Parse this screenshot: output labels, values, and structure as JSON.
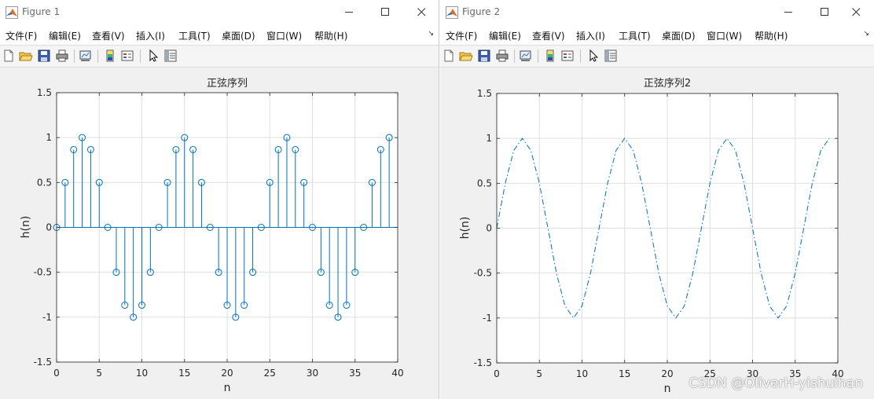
{
  "windows": [
    {
      "title": "Figure 1",
      "menu": [
        "文件(F)",
        "编辑(E)",
        "查看(V)",
        "插入(I)",
        "工具(T)",
        "桌面(D)",
        "窗口(W)",
        "帮助(H)"
      ],
      "menu_more": "↘",
      "toolbar_icons": [
        "new-figure-icon",
        "open-icon",
        "save-icon",
        "print-icon",
        "link-plot-icon",
        "colorbar-icon",
        "legend-icon",
        "select-pointer-icon",
        "property-inspector-icon"
      ]
    },
    {
      "title": "Figure 2",
      "menu": [
        "文件(F)",
        "编辑(E)",
        "查看(V)",
        "插入(I)",
        "工具(T)",
        "桌面(D)",
        "窗口(W)",
        "帮助(H)"
      ],
      "menu_more": "↘",
      "toolbar_icons": [
        "new-figure-icon",
        "open-icon",
        "save-icon",
        "print-icon",
        "link-plot-icon",
        "colorbar-icon",
        "legend-icon",
        "select-pointer-icon",
        "property-inspector-icon"
      ]
    }
  ],
  "watermark": "CSDN @OliverH-yishuihan",
  "colors": {
    "series": "#0072BD",
    "grid": "#dfdfdf",
    "axes_bg": "#ffffff",
    "figure_bg": "#f0f0f0"
  },
  "chart_data": [
    {
      "type": "stem",
      "title": "正弦序列",
      "xlabel": "n",
      "ylabel": "h(n)",
      "xlim": [
        0,
        40
      ],
      "ylim": [
        -1.5,
        1.5
      ],
      "xticks": [
        "0",
        "5",
        "10",
        "15",
        "20",
        "25",
        "30",
        "35",
        "40"
      ],
      "yticks": [
        "1.5",
        "1",
        "0.5",
        "0",
        "-0.5",
        "-1",
        "-1.5"
      ],
      "grid": true,
      "marker": "circle",
      "x": [
        0,
        1,
        2,
        3,
        4,
        5,
        6,
        7,
        8,
        9,
        10,
        11,
        12,
        13,
        14,
        15,
        16,
        17,
        18,
        19,
        20,
        21,
        22,
        23,
        24,
        25,
        26,
        27,
        28,
        29,
        30,
        31,
        32,
        33,
        34,
        35,
        36,
        37,
        38,
        39
      ],
      "y": [
        0,
        0.5,
        0.866,
        1,
        0.866,
        0.5,
        0,
        -0.5,
        -0.866,
        -1,
        -0.866,
        -0.5,
        0,
        0.5,
        0.866,
        1,
        0.866,
        0.5,
        0,
        -0.5,
        -0.866,
        -1,
        -0.866,
        -0.5,
        0,
        0.5,
        0.866,
        1,
        0.866,
        0.5,
        0,
        -0.5,
        -0.866,
        -1,
        -0.866,
        -0.5,
        0,
        0.5,
        0.866,
        1
      ]
    },
    {
      "type": "line",
      "line_style": "dash-dot",
      "title": "正弦序列2",
      "xlabel": "n",
      "ylabel": "h(n)",
      "xlim": [
        0,
        40
      ],
      "ylim": [
        -1.5,
        1.5
      ],
      "xticks": [
        "0",
        "5",
        "10",
        "15",
        "20",
        "25",
        "30",
        "35",
        "40"
      ],
      "yticks": [
        "1.5",
        "1",
        "0.5",
        "0",
        "-0.5",
        "-1",
        "-1.5"
      ],
      "grid": true,
      "x": [
        0,
        1,
        2,
        3,
        4,
        5,
        6,
        7,
        8,
        9,
        10,
        11,
        12,
        13,
        14,
        15,
        16,
        17,
        18,
        19,
        20,
        21,
        22,
        23,
        24,
        25,
        26,
        27,
        28,
        29,
        30,
        31,
        32,
        33,
        34,
        35,
        36,
        37,
        38,
        39
      ],
      "y": [
        0,
        0.5,
        0.866,
        1,
        0.866,
        0.5,
        0,
        -0.5,
        -0.866,
        -1,
        -0.866,
        -0.5,
        0,
        0.5,
        0.866,
        1,
        0.866,
        0.5,
        0,
        -0.5,
        -0.866,
        -1,
        -0.866,
        -0.5,
        0,
        0.5,
        0.866,
        1,
        0.866,
        0.5,
        0,
        -0.5,
        -0.866,
        -1,
        -0.866,
        -0.5,
        0,
        0.5,
        0.866,
        1
      ]
    }
  ]
}
